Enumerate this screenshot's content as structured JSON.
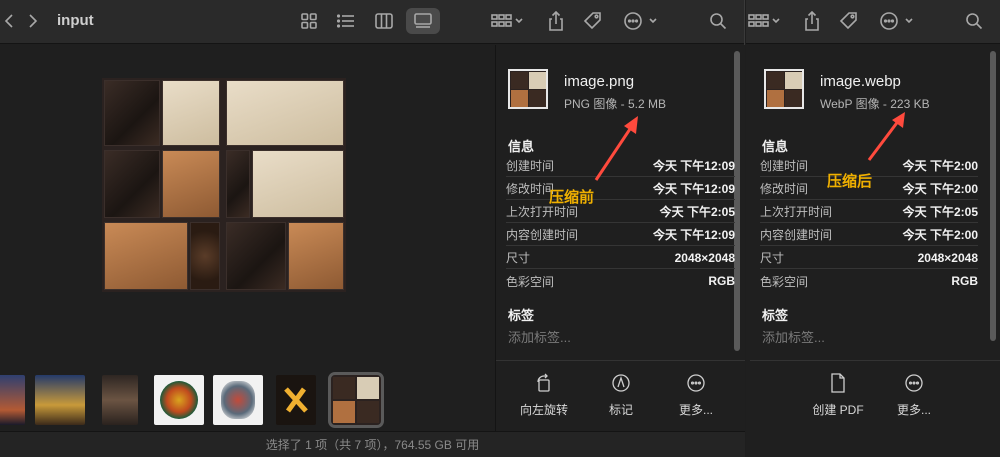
{
  "left_window": {
    "folder_title": "input",
    "status_text": "选择了 1 项（共 7 项），764.55 GB 可用",
    "inspector": {
      "file_name": "image.png",
      "file_kind": "PNG 图像 - 5.2 MB",
      "info_title": "信息",
      "rows": [
        {
          "key": "创建时间",
          "value": "今天 下午12:09"
        },
        {
          "key": "修改时间",
          "value": "今天 下午12:09"
        },
        {
          "key": "上次打开时间",
          "value": "今天 下午2:05"
        },
        {
          "key": "内容创建时间",
          "value": "今天 下午12:09"
        },
        {
          "key": "尺寸",
          "value": "2048×2048"
        },
        {
          "key": "色彩空间",
          "value": "RGB"
        }
      ],
      "tags_title": "标签",
      "tags_placeholder": "添加标签...",
      "actions": [
        {
          "label": "向左旋转",
          "icon": "rotate-left-icon"
        },
        {
          "label": "标记",
          "icon": "markup-icon"
        },
        {
          "label": "更多...",
          "icon": "more-icon"
        }
      ]
    },
    "annotation": "压缩前"
  },
  "right_window": {
    "inspector": {
      "file_name": "image.webp",
      "file_kind": "WebP 图像 - 223 KB",
      "info_title": "信息",
      "rows": [
        {
          "key": "创建时间",
          "value": "今天 下午2:00"
        },
        {
          "key": "修改时间",
          "value": "今天 下午2:00"
        },
        {
          "key": "上次打开时间",
          "value": "今天 下午2:05"
        },
        {
          "key": "内容创建时间",
          "value": "今天 下午2:00"
        },
        {
          "key": "尺寸",
          "value": "2048×2048"
        },
        {
          "key": "色彩空间",
          "value": "RGB"
        }
      ],
      "tags_title": "标签",
      "tags_placeholder": "添加标签...",
      "actions": [
        {
          "label": "创建 PDF",
          "icon": "document-icon"
        },
        {
          "label": "更多...",
          "icon": "more-icon"
        }
      ]
    },
    "annotation": "压缩后"
  },
  "colors": {
    "annotation": "#f0b000",
    "arrow": "#ff4a3d",
    "window_bg": "#1f1f1f",
    "toolbar_bg": "#2a2a2a"
  }
}
